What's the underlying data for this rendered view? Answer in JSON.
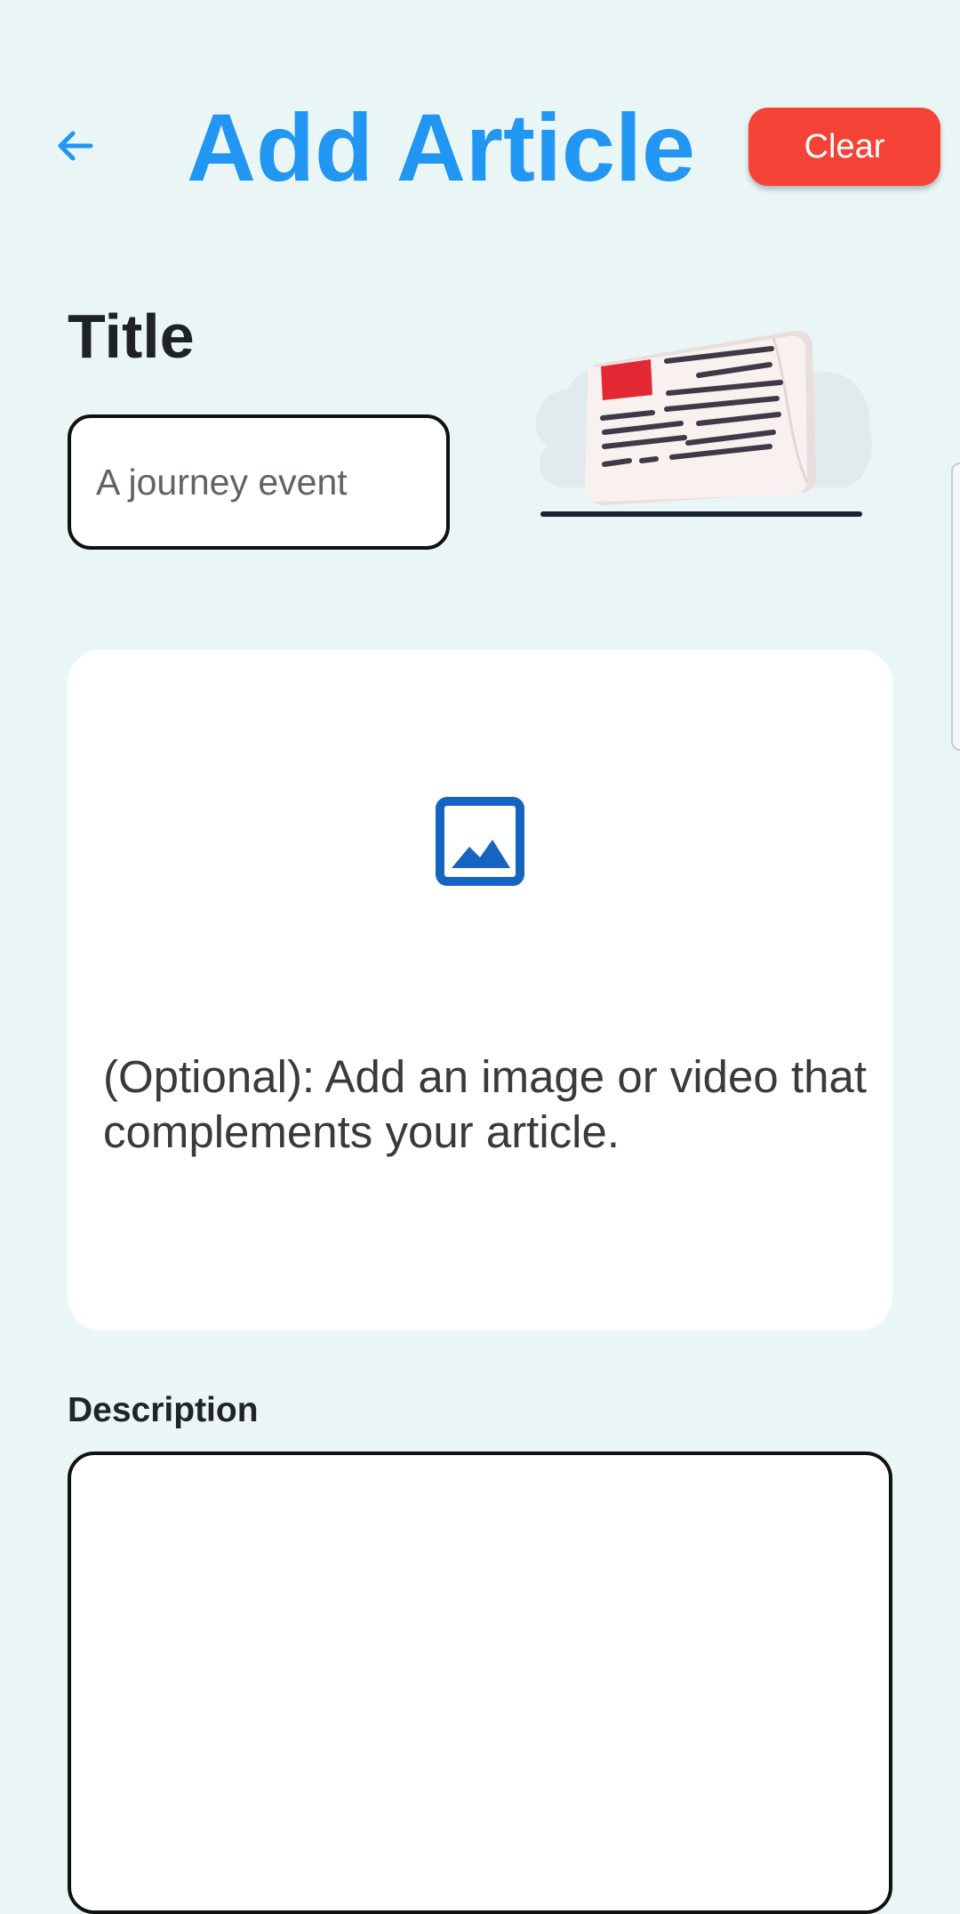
{
  "header": {
    "back_icon": "arrow-back-icon",
    "title": "Add Article",
    "clear_label": "Clear"
  },
  "title_section": {
    "label": "Title",
    "input_value": "A journey event",
    "illustration_icon": "newspaper-illustration"
  },
  "media": {
    "icon": "image-icon",
    "hint": "(Optional): Add an image or video that complements your article."
  },
  "description": {
    "label": "Description",
    "value": ""
  },
  "colors": {
    "background": "#EAF5F5",
    "accent": "#2196F3",
    "clear_button": "#F44336",
    "media_icon": "#1565C0"
  }
}
